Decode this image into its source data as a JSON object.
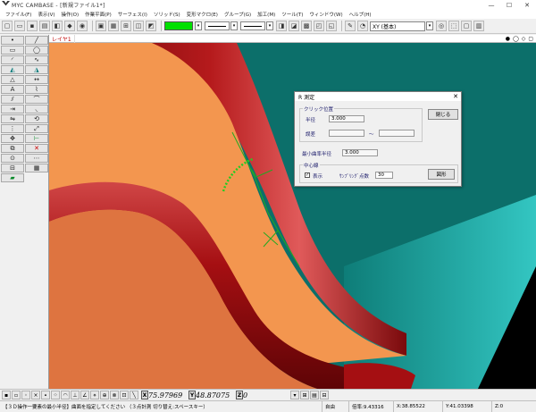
{
  "window": {
    "title": "MYC CAMBASE - [新規ファイル1*]",
    "minimize": "—",
    "maximize": "☐",
    "close": "✕"
  },
  "menu": [
    "ファイル(F)",
    "表示(V)",
    "操作(O)",
    "作業平面(P)",
    "サーフェス(I)",
    "ソリッド(S)",
    "変形マクロ(E)",
    "グループ(G)",
    "加工(M)",
    "ツール(T)",
    "ウィンドウ(W)",
    "ヘルプ(H)"
  ],
  "toolbar": {
    "active_color": "#00e000",
    "plane_select": "XY (基本)"
  },
  "layer_tab": "レイヤ1",
  "tab_icons": [
    "●",
    "◯",
    "◇",
    "▢"
  ],
  "dialog": {
    "title": "R 測定",
    "close_label": "✕",
    "click_group": "クリック位置",
    "radius_label": "半径",
    "radius_value": "3.000",
    "error_label": "誤差",
    "error_from": "",
    "error_sep": "～",
    "error_to": "",
    "close_button": "閉じる",
    "min_radius_label": "最小曲率半径",
    "min_radius_value": "3.000",
    "center_group": "中心線",
    "show_label": "表示",
    "show_checked": "✓",
    "sampling_label": "ｻﾝﾌﾟﾘﾝｸﾞ点数",
    "sampling_value": "30",
    "diagram_button": "図形"
  },
  "coords": {
    "x_tag": "X",
    "x_value": "75.97969",
    "y_tag": "Y",
    "y_value": "48.87075",
    "z_tag": "Z",
    "z_value": "0"
  },
  "status": {
    "message": "【３Ｄ操作一要素の最小半径】曲面を指定してください （３点計測 切り替え:スペースキー）",
    "mode": "自由",
    "magnification": "倍率:9.43316",
    "x": "X:38.85522",
    "y": "Y:41.03398",
    "z": "Z:0"
  },
  "colors": {
    "background": "#0c6f6a",
    "surface_orange": "#f3964f",
    "surface_orange_dark": "#de7440",
    "tube_red": "#a50f12",
    "center_line": "#22aa22"
  }
}
